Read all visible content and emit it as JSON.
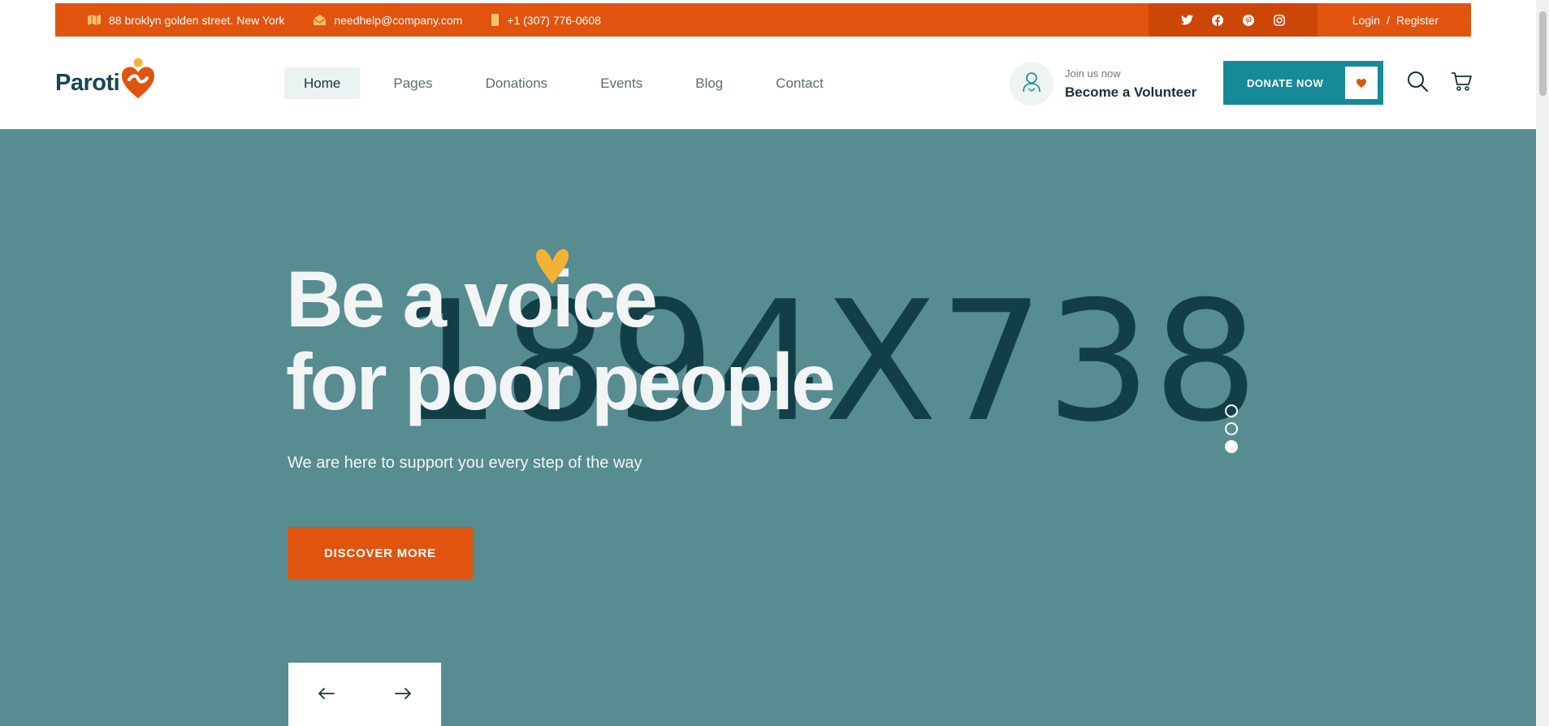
{
  "topbar": {
    "address": "88 broklyn golden street. New York",
    "email": "needhelp@company.com",
    "phone": "+1 (307) 776-0608",
    "login": "Login",
    "separator": "/",
    "register": "Register"
  },
  "header": {
    "logo": "Paroti",
    "nav": [
      "Home",
      "Pages",
      "Donations",
      "Events",
      "Blog",
      "Contact"
    ],
    "active_nav": "Home",
    "volunteer_small": "Join us now",
    "volunteer_big": "Become a Volunteer",
    "donate": "DONATE NOW"
  },
  "hero": {
    "placeholder": "1894X738",
    "title_line1": "Be a voice",
    "title_line2": "for poor people",
    "subtitle": "We are here to support you every step of the way",
    "cta": "DISCOVER MORE",
    "slides": 3,
    "active_slide": 3
  },
  "colors": {
    "orange": "#e0540f",
    "teal": "#178a98",
    "hero_bg": "#578c90",
    "dark": "#17323a",
    "yellow": "#f4b234"
  }
}
